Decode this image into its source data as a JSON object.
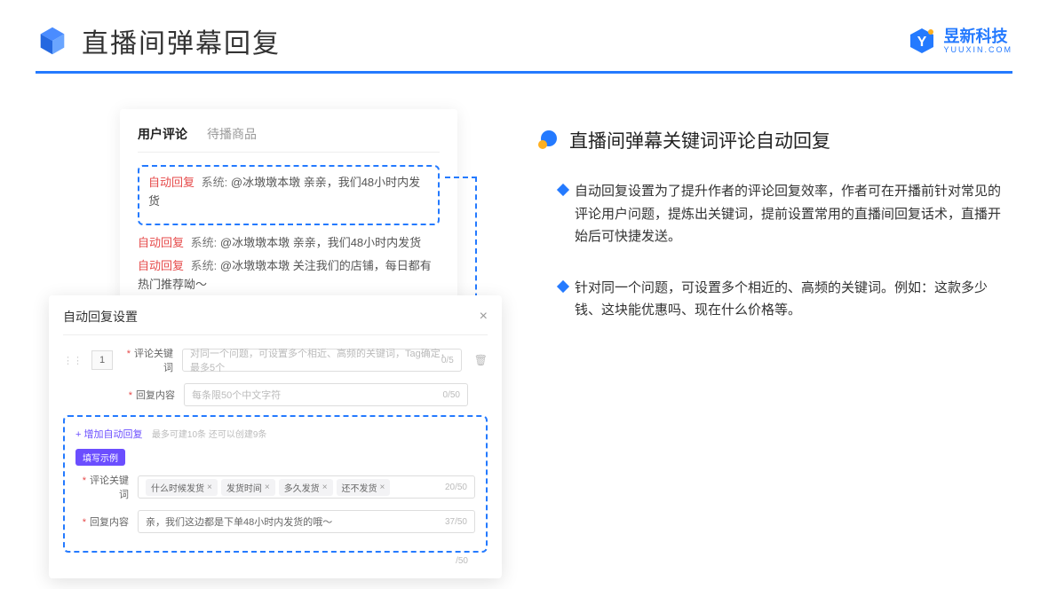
{
  "header": {
    "title": "直播间弹幕回复",
    "brand": "昱新科技",
    "brand_sub": "YUUXIN.COM"
  },
  "card": {
    "tab_active": "用户评论",
    "tab_other": "待播商品",
    "highlight": {
      "tag": "自动回复",
      "sys": "系统:",
      "text": "@冰墩墩本墩 亲亲，我们48小时内发货"
    },
    "line2": {
      "tag": "自动回复",
      "sys": "系统:",
      "text": "@冰墩墩本墩 亲亲，我们48小时内发货"
    },
    "line3": {
      "tag": "自动回复",
      "sys": "系统:",
      "text": "@冰墩墩本墩 关注我们的店铺，每日都有热门推荐呦～"
    }
  },
  "modal": {
    "title": "自动回复设置",
    "num": "1",
    "keyword_label": "评论关键词",
    "keyword_placeholder": "对同一个问题，可设置多个相近、高频的关键词，Tag确定，最多5个",
    "keyword_counter": "0/5",
    "reply_label": "回复内容",
    "reply_placeholder": "每条限50个中文字符",
    "reply_counter": "0/50",
    "add_link": "+ 增加自动回复",
    "add_hint": "最多可建10条 还可以创建9条",
    "example_label": "填写示例",
    "ex_kw_label": "评论关键词",
    "ex_tags": [
      "什么时候发货",
      "发货时间",
      "多久发货",
      "还不发货"
    ],
    "ex_kw_counter": "20/50",
    "ex_reply_label": "回复内容",
    "ex_reply_text": "亲，我们这边都是下单48小时内发货的哦～",
    "ex_reply_counter": "37/50",
    "outer_counter": "/50"
  },
  "right": {
    "section_title": "直播间弹幕关键词评论自动回复",
    "bullet1": "自动回复设置为了提升作者的评论回复效率，作者可在开播前针对常见的评论用户问题，提炼出关键词，提前设置常用的直播间回复话术，直播开始后可快捷发送。",
    "bullet2": "针对同一个问题，可设置多个相近的、高频的关键词。例如：这款多少钱、这块能优惠吗、现在什么价格等。"
  }
}
